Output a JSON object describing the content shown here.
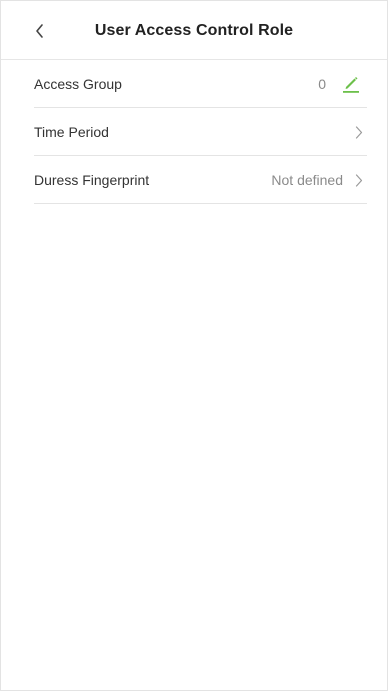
{
  "header": {
    "title": "User Access Control Role",
    "back_icon": "chevron-left-icon"
  },
  "rows": [
    {
      "label": "Access Group",
      "value": "0",
      "icon": "pencil-icon",
      "icon_color": "#6cc04a"
    },
    {
      "label": "Time Period",
      "value": "",
      "icon": "chevron-right-icon"
    },
    {
      "label": "Duress Fingerprint",
      "value": "Not defined",
      "icon": "chevron-right-icon"
    }
  ],
  "colors": {
    "accent": "#6cc04a",
    "divider": "#e4e4e4",
    "text": "#333333",
    "secondary_text": "#8a8a8a"
  }
}
